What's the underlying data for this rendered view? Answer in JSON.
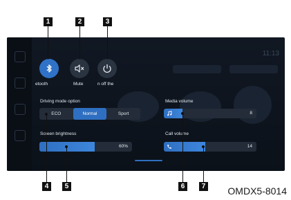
{
  "callouts": [
    "1",
    "2",
    "3",
    "4",
    "5",
    "6",
    "7"
  ],
  "status": {
    "time": "11:13"
  },
  "quick_buttons": {
    "bluetooth": {
      "label": "etooth",
      "icon": "bluetooth-icon",
      "state": "on"
    },
    "mute": {
      "label": "Mute",
      "icon": "mute-icon",
      "state": "off"
    },
    "power": {
      "label": "n off the",
      "icon": "power-icon",
      "state": "off"
    }
  },
  "driving_mode": {
    "title": "Driving mode option",
    "options": [
      "ECO",
      "Normal",
      "Sport"
    ],
    "selected": "Normal"
  },
  "screen_brightness": {
    "title": "Screen brightness",
    "value_text": "60%",
    "level": 0.6
  },
  "media_volume": {
    "title": "Media volume",
    "value_text": "8",
    "level": 0.2,
    "icon": "music-note-icon"
  },
  "call_volume": {
    "title": "Call volume",
    "value_text": "14",
    "level": 0.45,
    "icon": "phone-icon"
  },
  "image_code": "OMDX5-8014",
  "colors": {
    "accent": "#2f6fc1",
    "panel": "#111823",
    "track": "#232c38"
  }
}
